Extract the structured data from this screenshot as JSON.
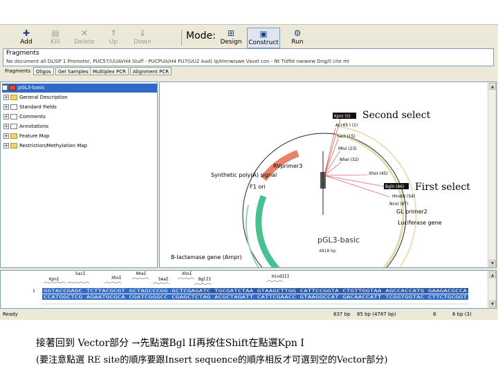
{
  "toolbar": {
    "buttons": [
      {
        "label": "Add",
        "icon": "add-icon"
      },
      {
        "label": "Kill",
        "icon": "kill-icon"
      },
      {
        "label": "Delete",
        "icon": "delete-icon"
      },
      {
        "label": "Up",
        "icon": "up-icon"
      },
      {
        "label": "Down",
        "icon": "down-icon"
      }
    ],
    "mode_label": "Mode:",
    "mode_buttons": [
      {
        "label": "Design",
        "icon": "design-icon"
      },
      {
        "label": "Construct",
        "icon": "construct-icon"
      },
      {
        "label": "Run",
        "icon": "run-icon"
      }
    ]
  },
  "fragments": {
    "title": "Fragments",
    "content": "No document all DLISP 1 Promoter, PUC57/UUAVH4 Stuff - PUCPUA/H4 PU7(UU2 Aud) Ip/Hnnwiswe Vavel con - Nt Tidfid nwiwew Dng/ll cite ml"
  },
  "tabs": [
    "Fragments",
    "Oligos",
    "Gel Samples",
    "Multiplex PCR",
    "Alignment PCR"
  ],
  "tree": {
    "root": "pGL3-basic",
    "items": [
      "General Description",
      "Standard Fields",
      "Comments",
      "Annotations",
      "Feature Map",
      "Restriction/Methylation Map"
    ]
  },
  "map": {
    "annotation_second": "Second select",
    "annotation_first": "First select",
    "plasmid_name": "pGL3-basic",
    "plasmid_size": "4818 bp",
    "features": [
      "RVprimer3",
      "Synthetic poly(A) signal",
      "F1 ori",
      "GL primer2",
      "Luciferase gene",
      "B-lactamase gene (Ampr)"
    ],
    "sites": [
      "KpnI (5)",
      "Acc65 I (1)",
      "SacI (15)",
      "MluI (23)",
      "NheI (32)",
      "XhoI (45)",
      "BglII (86)",
      "HindIII (54)",
      "NcoI (87)"
    ]
  },
  "sequence": {
    "enzymes": [
      "SacI",
      "XhoI",
      "NheI",
      "SmaI",
      "XhoI",
      "BglII",
      "HindIII",
      "KpnI"
    ],
    "line_number": "1",
    "top_strand": "GGTACCGAGC TCTTACGCGT GCTAGCCCGG GCTCGAGATC TGCGATCTAA GTAAGCTTGG CATTCCGGTA CTGTTGGTAA AGCCACCATG GAAGACGCCA",
    "bottom_strand": "CCATGGCTCG AGAATGCGCA CGATCGGGCC CGAGCTCTAG ACGCTAGATT CATTCGAACC GTAAGGCCAT GACAACCATT TCGGTGGTAC CTTCTGCGGT"
  },
  "status": {
    "left": "Ready",
    "pos": "837 bp",
    "sel": "85 bp (4787 bp)",
    "num": "8",
    "right": "6 bp (3)"
  },
  "caption": {
    "line1": "接著回到 Vector部分 →先點選Bgl II再按住Shift在點選Kpn I",
    "line2": "(要注意點選 RE site的順序要跟Insert sequence的順序相反才可選到空的Vector部分)"
  },
  "colors": {
    "selection": "#316ac5",
    "f1ori": "#e8826a",
    "ampr": "#46c18f",
    "luciferase": "#e0dcaa"
  }
}
